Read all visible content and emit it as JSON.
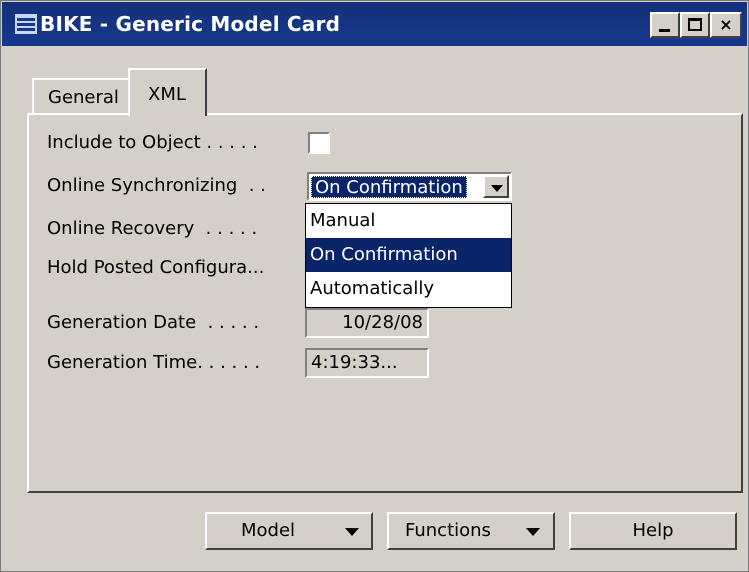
{
  "window": {
    "title": "BIKE - Generic Model Card",
    "controls": {
      "minimize": "minimize-icon",
      "maximize": "maximize-icon",
      "close": "×"
    }
  },
  "tabs": [
    {
      "label": "General",
      "active": false
    },
    {
      "label": "XML",
      "active": true
    }
  ],
  "fields": {
    "include_to_object": {
      "label": "Include to Object . . . . .",
      "checked": false
    },
    "online_synchronizing": {
      "label": "Online Synchronizing  . .",
      "value": "On Confirmation"
    },
    "online_recovery": {
      "label": "Online Recovery  . . . . ."
    },
    "hold_posted_configuration": {
      "label": "Hold Posted Configura..."
    },
    "generation_date": {
      "label": "Generation Date  . . . . .",
      "value": "10/28/08"
    },
    "generation_time": {
      "label": "Generation Time. . . . . .",
      "value": "4:19:33..."
    }
  },
  "dropdown": {
    "options": [
      "Manual",
      "On Confirmation",
      "Automatically"
    ],
    "selected": "On Confirmation"
  },
  "buttons": {
    "model": "Model",
    "functions": "Functions",
    "help": "Help"
  },
  "colors": {
    "title_bar": "#16388c",
    "selection": "#0a246a",
    "face": "#d4d0c8"
  }
}
